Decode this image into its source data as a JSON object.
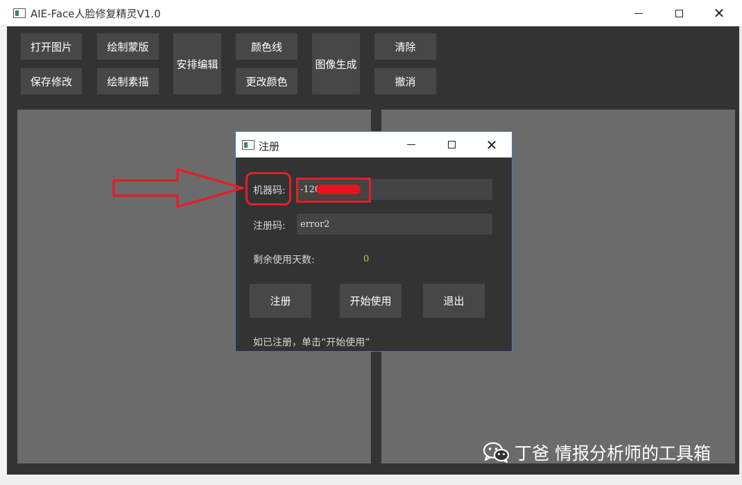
{
  "main_window": {
    "title": "AIE-Face人脸修复精灵V1.0"
  },
  "toolbar": {
    "open_image": "打开图片",
    "save_changes": "保存修改",
    "draw_mask": "绘制蒙版",
    "draw_sketch": "绘制素描",
    "arrange_edit": "安排编辑",
    "color_line": "颜色线",
    "change_color": "更改颜色",
    "generate_image": "图像生成",
    "clear": "清除",
    "undo": "撤消"
  },
  "dialog": {
    "title": "注册",
    "machine_code_label": "机器码:",
    "machine_code_value": "-120",
    "register_code_label": "注册码:",
    "register_code_value": "error2",
    "days_left_label": "剩余使用天数:",
    "days_left_value": "0",
    "register_button": "注册",
    "start_button": "开始使用",
    "exit_button": "退出",
    "hint": "如已注册，单击“开始使用”"
  },
  "watermark": {
    "icon": "wechat-icon",
    "text": "丁爸 情报分析师的工具箱"
  },
  "colors": {
    "window_bg": "#333333",
    "button_bg": "#474747",
    "canvas_bg": "#6b6b6b",
    "annotation_red": "#e0202a",
    "days_value": "#d8c84a"
  }
}
